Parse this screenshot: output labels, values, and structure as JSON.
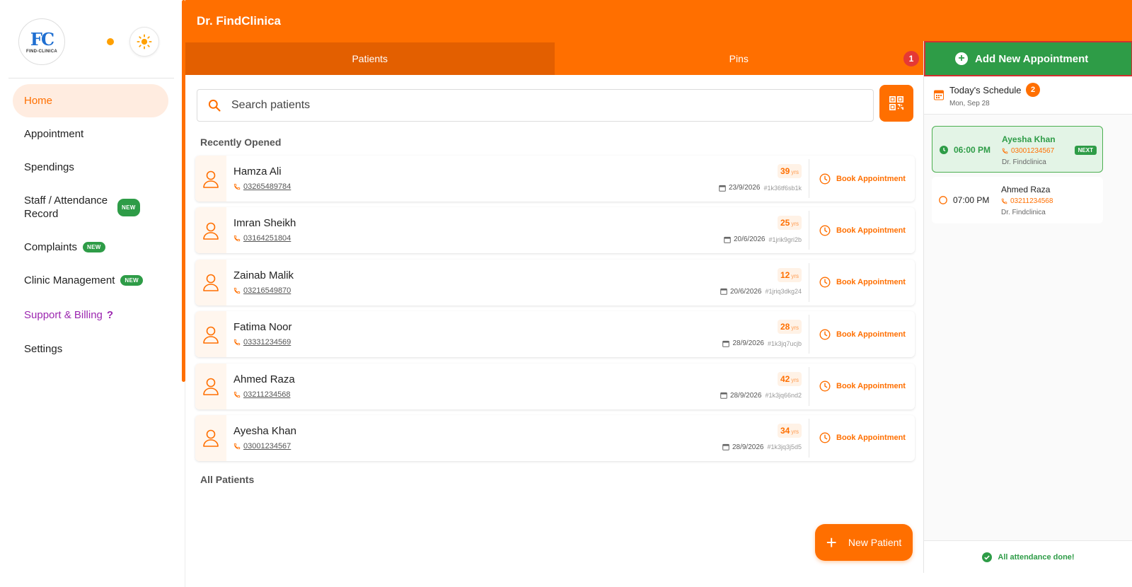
{
  "header": {
    "title": "Dr. FindClinica"
  },
  "logo": {
    "mark": "FC",
    "text": "FIND-CLINICA"
  },
  "sidebar": {
    "items": [
      {
        "label": "Home",
        "badge": ""
      },
      {
        "label": "Appointment",
        "badge": ""
      },
      {
        "label": "Spendings",
        "badge": ""
      },
      {
        "label": "Staff / Attendance Record",
        "badge": "NEW"
      },
      {
        "label": "Complaints",
        "badge": "NEW"
      },
      {
        "label": "Clinic Management",
        "badge": "NEW"
      },
      {
        "label": "Support & Billing",
        "badge": ""
      },
      {
        "label": "Settings",
        "badge": ""
      }
    ],
    "help_mark": "?"
  },
  "tabs": [
    {
      "label": "Patients",
      "badge": ""
    },
    {
      "label": "Pins",
      "badge": "1"
    }
  ],
  "search": {
    "placeholder": "Search patients",
    "value": ""
  },
  "sections": {
    "recent": "Recently Opened",
    "all": "All Patients"
  },
  "patients": [
    {
      "name": "Hamza Ali",
      "phone": "03265489784",
      "age": "39",
      "age_unit": "yrs",
      "date": "23/9/2026",
      "id": "#1k36tf6sb1k",
      "action": "Book Appointment"
    },
    {
      "name": "Imran Sheikh",
      "phone": "03164251804",
      "age": "25",
      "age_unit": "yrs",
      "date": "20/6/2026",
      "id": "#1jrik9gri2b",
      "action": "Book Appointment"
    },
    {
      "name": "Zainab Malik",
      "phone": "03216549870",
      "age": "12",
      "age_unit": "yrs",
      "date": "20/6/2026",
      "id": "#1jriq3dkg24",
      "action": "Book Appointment"
    },
    {
      "name": "Fatima Noor",
      "phone": "03331234569",
      "age": "28",
      "age_unit": "yrs",
      "date": "28/9/2026",
      "id": "#1k3jq7ucjb",
      "action": "Book Appointment"
    },
    {
      "name": "Ahmed Raza",
      "phone": "03211234568",
      "age": "42",
      "age_unit": "yrs",
      "date": "28/9/2026",
      "id": "#1k3jq66nd2",
      "action": "Book Appointment"
    },
    {
      "name": "Ayesha Khan",
      "phone": "03001234567",
      "age": "34",
      "age_unit": "yrs",
      "date": "28/9/2026",
      "id": "#1k3jq3j5d5",
      "action": "Book Appointment"
    }
  ],
  "fab": {
    "label": "New Patient"
  },
  "right_panel": {
    "add_button": "Add New Appointment",
    "schedule_title": "Today's Schedule",
    "schedule_count": "2",
    "schedule_date": "Mon, Sep 28",
    "appointments": [
      {
        "time": "06:00 PM",
        "name": "Ayesha Khan",
        "phone": "03001234567",
        "doctor": "Dr. Findclinica",
        "badge": "NEXT"
      },
      {
        "time": "07:00 PM",
        "name": "Ahmed Raza",
        "phone": "03211234568",
        "doctor": "Dr. Findclinica",
        "badge": ""
      }
    ],
    "attendance": "All attendance done!"
  },
  "colors": {
    "accent": "#ff6f00",
    "success": "#2e9c47",
    "danger": "#e53935",
    "support": "#9c27b0"
  }
}
